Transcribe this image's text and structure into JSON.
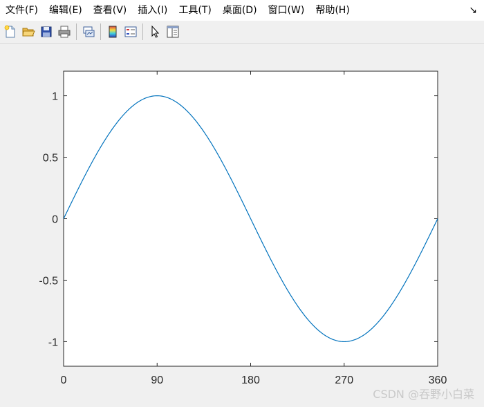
{
  "menu": {
    "file": "文件(F)",
    "edit": "编辑(E)",
    "view": "查看(V)",
    "insert": "插入(I)",
    "tools": "工具(T)",
    "desktop": "桌面(D)",
    "window": "窗口(W)",
    "help": "帮助(H)",
    "dock_arrow": "↘"
  },
  "toolbar": {
    "buttons": [
      "new-figure",
      "open-file",
      "save",
      "print",
      "link-plot",
      "insert-colorbar",
      "insert-legend",
      "edit-plot",
      "property-editor"
    ]
  },
  "chart_data": {
    "type": "line",
    "title": "",
    "xlabel": "",
    "ylabel": "",
    "xlim": [
      0,
      360
    ],
    "ylim": [
      -1.2,
      1.2
    ],
    "xticks": [
      0,
      90,
      180,
      270,
      360
    ],
    "xtick_labels": [
      "0",
      "90",
      "180",
      "270",
      "360"
    ],
    "yticks": [
      1,
      0.5,
      0,
      -0.5,
      -1
    ],
    "ytick_labels": [
      "1",
      "0.5",
      "0",
      "-0.5",
      "-1"
    ],
    "grid": false,
    "series": [
      {
        "color": "#0072bd",
        "function": "sin(x degrees)",
        "x": [
          0,
          15,
          30,
          45,
          60,
          75,
          90,
          105,
          120,
          135,
          150,
          165,
          180,
          195,
          210,
          225,
          240,
          255,
          270,
          285,
          300,
          315,
          330,
          345,
          360
        ],
        "y": [
          0,
          0.259,
          0.5,
          0.707,
          0.866,
          0.966,
          1,
          0.966,
          0.866,
          0.707,
          0.5,
          0.259,
          0,
          -0.259,
          -0.5,
          -0.707,
          -0.866,
          -0.966,
          -1,
          -0.966,
          -0.866,
          -0.707,
          -0.5,
          -0.259,
          0
        ]
      }
    ]
  },
  "watermark": "CSDN @吞野小白菜"
}
